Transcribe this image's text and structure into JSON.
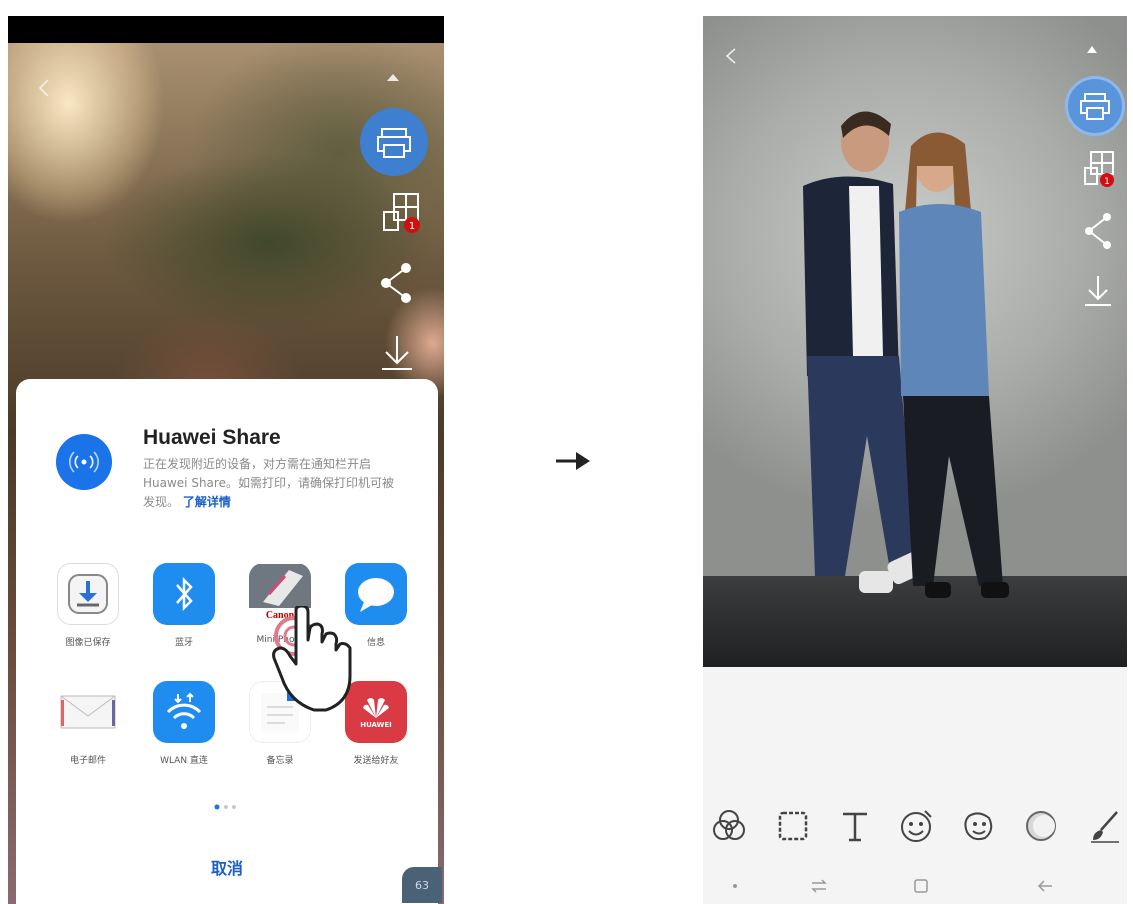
{
  "left_phone": {
    "sheet": {
      "title": "Huawei Share",
      "description": "正在发现附近的设备，对方需在通知栏开启 Huawei Share。如需打印，请确保打印机可被发现。",
      "link": "了解详情",
      "apps_row1": [
        {
          "label": "图像已保存",
          "icon": "save-download-icon"
        },
        {
          "label": "蓝牙",
          "icon": "bluetooth-icon"
        },
        {
          "label": "Mini Photo",
          "icon": "canon-mini-photo-icon",
          "brand": "Canon"
        },
        {
          "label": "信息",
          "icon": "messages-icon"
        }
      ],
      "apps_row2": [
        {
          "label": "电子邮件",
          "icon": "email-icon"
        },
        {
          "label": "WLAN 直连",
          "icon": "wlan-direct-icon"
        },
        {
          "label": "备忘录",
          "icon": "notes-icon"
        },
        {
          "label": "发送给好友",
          "icon": "huawei-send-icon",
          "brand": "HUAWEI"
        }
      ],
      "cancel_label": "取消",
      "page_indicator": {
        "pages": 3,
        "current": 1
      }
    },
    "print_queue_badge": "1",
    "corner_badge": "63"
  },
  "right_phone": {
    "print_queue_badge": "1",
    "tools": [
      "filters-icon",
      "frame-icon",
      "text-icon",
      "sticker-icon",
      "face-sticker-icon",
      "adjust-icon",
      "brush-icon"
    ]
  },
  "colors": {
    "accent_blue": "#1a73e8",
    "link_blue": "#1a5fc9",
    "badge_red": "#d01010"
  }
}
